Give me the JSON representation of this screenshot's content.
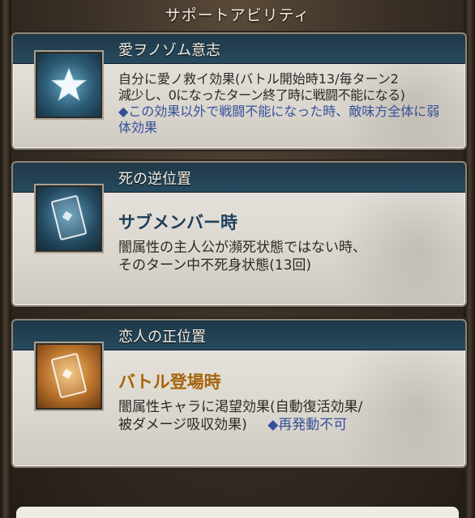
{
  "header": {
    "title": "サポートアビリティ"
  },
  "abilities": [
    {
      "name": "愛ヲノゾム意志",
      "icon": "star-icon",
      "desc_line1": "自分に愛ノ救イ効果(バトル開始時13/毎ターン2",
      "desc_line2": "減少し、0になったターン終了時に戦闘不能になる)",
      "desc_blue": "◆この効果以外で戦闘不能になった時、敵味方全体に弱体効果"
    },
    {
      "name": "死の逆位置",
      "icon": "tarot-card-icon",
      "subtitle": "サブメンバー時",
      "desc_line1": "闇属性の主人公が瀕死状態ではない時、",
      "desc_line2": "そのターン中不死身状態(13回)"
    },
    {
      "name": "恋人の正位置",
      "icon": "tarot-card-icon",
      "subtitle": "バトル登場時",
      "desc_line1": "闇属性キャラに渇望効果(自動復活効果/",
      "desc_line2": "被ダメージ吸収効果)",
      "desc_blue": "◆再発動不可"
    }
  ],
  "colors": {
    "accent_blue": "#36509a",
    "gold_subtitle": "#a26413",
    "panel_bar": "#274a5e"
  }
}
